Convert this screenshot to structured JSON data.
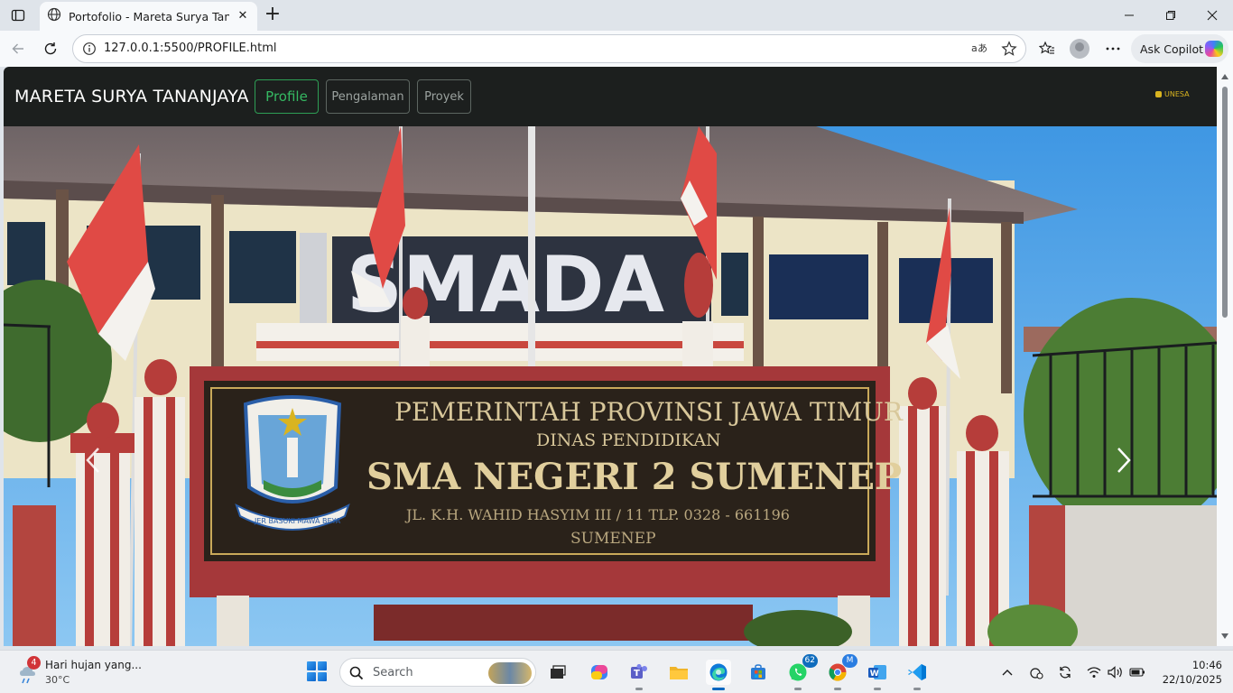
{
  "browser": {
    "tab_title": "Portofolio - Mareta Surya Tananjaya",
    "url": "127.0.0.1:5500/PROFILE.html",
    "copilot_label": "Ask Copilot"
  },
  "site": {
    "brand": "MARETA SURYA TANANJAYA",
    "nav": [
      {
        "label": "Profile",
        "active": true
      },
      {
        "label": "Pengalaman",
        "active": false
      },
      {
        "label": "Proyek",
        "active": false
      }
    ],
    "logo_text": "UNESA",
    "accent_color": "#35b862",
    "navbar_color": "#1c1f1e"
  },
  "carousel": {
    "building_sign": "SMADA",
    "sign_line1": "PEMERINTAH PROVINSI JAWA TIMUR",
    "sign_line2": "DINAS PENDIDIKAN",
    "sign_line3": "SMA NEGERI 2 SUMENEP",
    "sign_line4": "JL. K.H. WAHID HASYIM III / 11  TLP. 0328 - 661196",
    "sign_line5": "SUMENEP",
    "emblem_text": "JER BASUKI MAWA BEYA",
    "prev_icon": "chevron-left-icon",
    "next_icon": "chevron-right-icon"
  },
  "taskbar": {
    "weather_text": "Hari hujan yang...",
    "weather_temp": "30°C",
    "weather_badge": "4",
    "search_placeholder": "Search",
    "whatsapp_badge": "62",
    "chrome_badge": "M",
    "time": "10:46",
    "date": "22/10/2025"
  }
}
